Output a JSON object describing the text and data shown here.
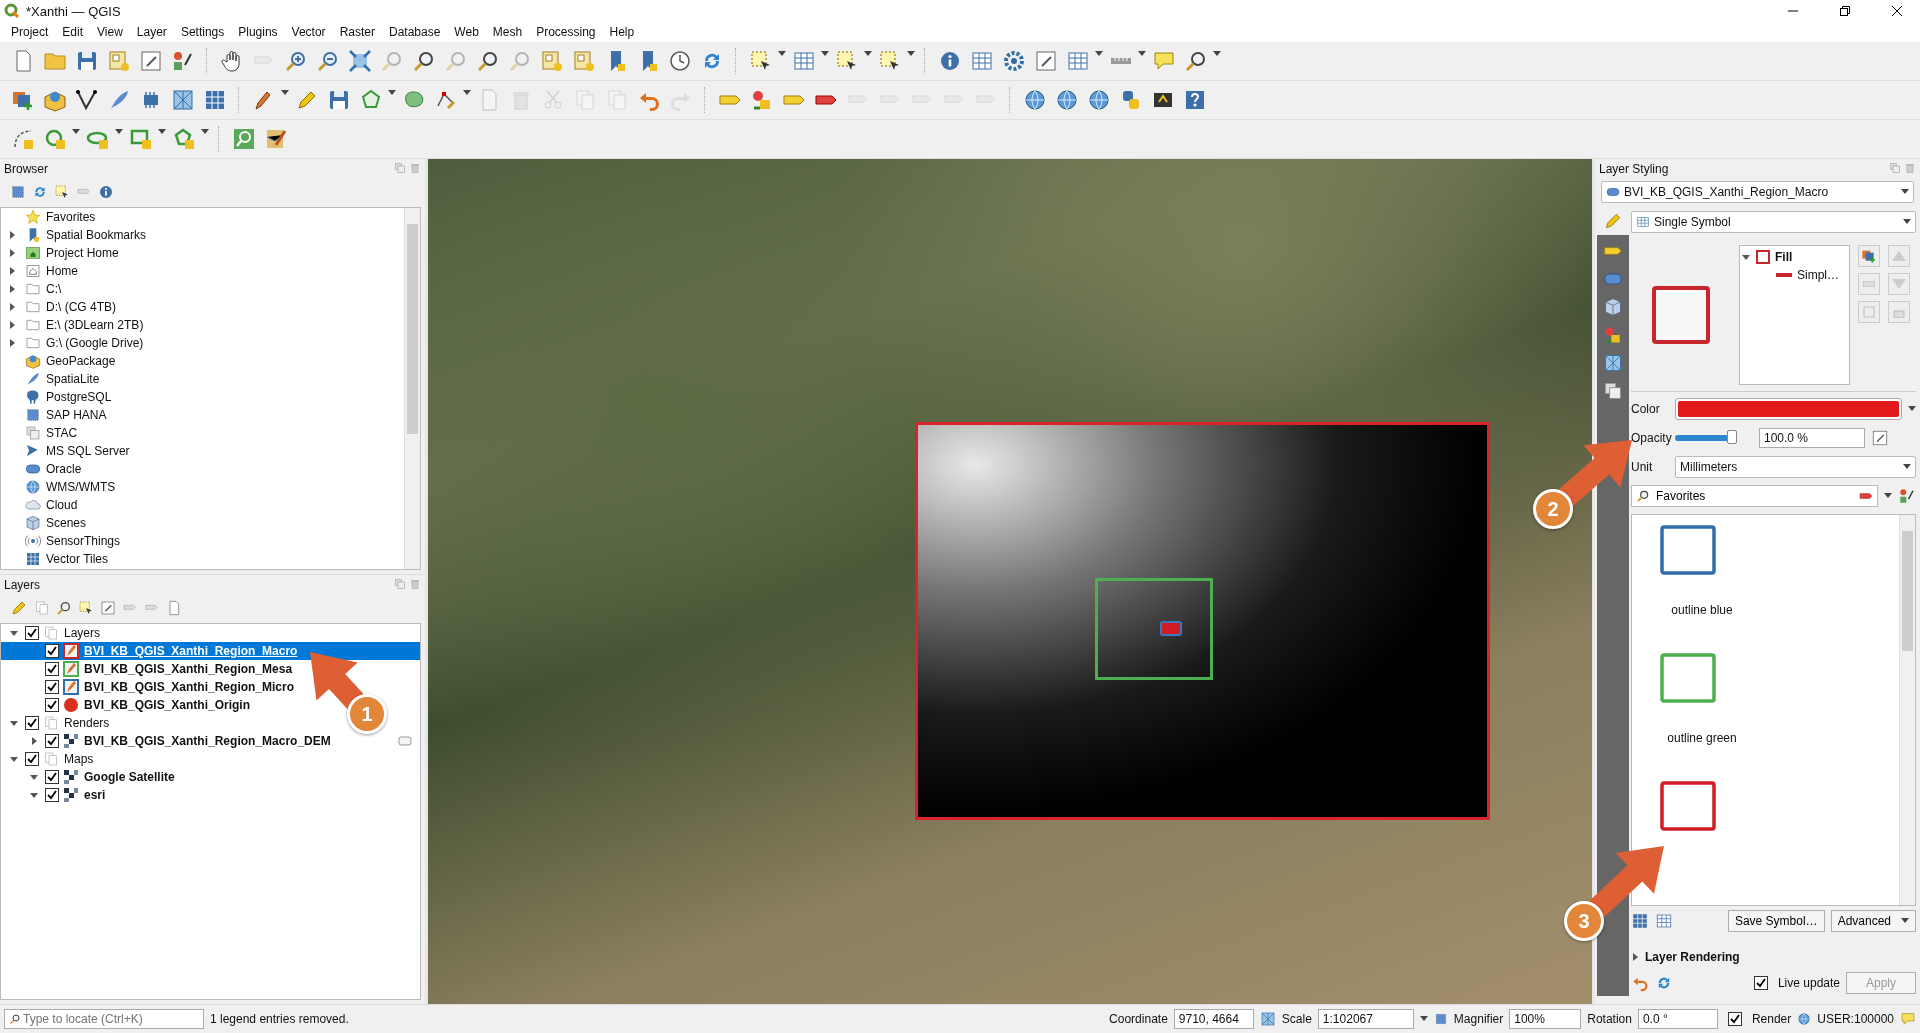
{
  "window": {
    "title": "*Xanthi — QGIS"
  },
  "menu": [
    "Project",
    "Edit",
    "View",
    "Layer",
    "Settings",
    "Plugins",
    "Vector",
    "Raster",
    "Database",
    "Web",
    "Mesh",
    "Processing",
    "Help"
  ],
  "browser": {
    "title": "Browser",
    "items": [
      {
        "label": "Favorites",
        "kind": "star",
        "expandable": false
      },
      {
        "label": "Spatial Bookmarks",
        "kind": "bookmark",
        "expandable": true
      },
      {
        "label": "Project Home",
        "kind": "project",
        "expandable": true
      },
      {
        "label": "Home",
        "kind": "home",
        "expandable": true
      },
      {
        "label": "C:\\",
        "kind": "folder",
        "expandable": true
      },
      {
        "label": "D:\\ (CG 4TB)",
        "kind": "folder",
        "expandable": true
      },
      {
        "label": "E:\\ (3DLearn 2TB)",
        "kind": "folder",
        "expandable": true
      },
      {
        "label": "G:\\ (Google Drive)",
        "kind": "folder",
        "expandable": true
      },
      {
        "label": "GeoPackage",
        "kind": "geopackage",
        "expandable": false
      },
      {
        "label": "SpatiaLite",
        "kind": "feather",
        "expandable": false
      },
      {
        "label": "PostgreSQL",
        "kind": "elephant",
        "expandable": false
      },
      {
        "label": "SAP HANA",
        "kind": "dotted-square",
        "expandable": false
      },
      {
        "label": "STAC",
        "kind": "stack",
        "expandable": false
      },
      {
        "label": "MS SQL Server",
        "kind": "fish",
        "expandable": false
      },
      {
        "label": "Oracle",
        "kind": "oval",
        "expandable": false
      },
      {
        "label": "WMS/WMTS",
        "kind": "globe",
        "expandable": false
      },
      {
        "label": "Cloud",
        "kind": "cloud",
        "expandable": false
      },
      {
        "label": "Scenes",
        "kind": "cube",
        "expandable": false
      },
      {
        "label": "SensorThings",
        "kind": "sensor",
        "expandable": false
      },
      {
        "label": "Vector Tiles",
        "kind": "grid",
        "expandable": false
      }
    ]
  },
  "layers": {
    "title": "Layers",
    "tree": [
      {
        "label": "Layers",
        "kind": "group",
        "checked": true,
        "expanded": true,
        "selected": false,
        "children": [
          {
            "label": "BVI_KB_QGIS_Xanthi_Region_Macro",
            "kind": "polygon",
            "color": "#c8262c",
            "checked": true,
            "selected": true
          },
          {
            "label": "BVI_KB_QGIS_Xanthi_Region_Mesa",
            "kind": "polygon",
            "color": "#4caf50",
            "checked": true,
            "selected": false
          },
          {
            "label": "BVI_KB_QGIS_Xanthi_Region_Micro",
            "kind": "polygon",
            "color": "#2f6ea8",
            "checked": true,
            "selected": false
          },
          {
            "label": "BVI_KB_QGIS_Xanthi_Origin",
            "kind": "point",
            "color": "#d7301f",
            "checked": true,
            "selected": false
          }
        ]
      },
      {
        "label": "Renders",
        "kind": "group",
        "checked": true,
        "expanded": true,
        "selected": false,
        "children": [
          {
            "label": "BVI_KB_QGIS_Xanthi_Region_Macro_DEM",
            "kind": "raster",
            "checked": true,
            "expanded": false,
            "selected": false,
            "embedded_widget": true
          }
        ]
      },
      {
        "label": "Maps",
        "kind": "group",
        "checked": true,
        "expanded": true,
        "selected": false,
        "children": [
          {
            "label": "Google Satellite",
            "kind": "raster",
            "checked": true,
            "expanded": true,
            "selected": false,
            "embedded_widget": false
          },
          {
            "label": "esri",
            "kind": "raster",
            "checked": true,
            "expanded": true,
            "selected": false,
            "embedded_widget": false
          }
        ]
      }
    ]
  },
  "styling": {
    "title": "Layer Styling",
    "layer": "BVI_KB_QGIS_Xanthi_Region_Macro",
    "renderer": "Single Symbol",
    "symbol_tree": {
      "label": "Fill",
      "color": "#c8262c",
      "expanded": true,
      "children": [
        {
          "label": "Simpl…",
          "color": "#c8262c"
        }
      ]
    },
    "color_field": {
      "label": "Color",
      "color": "#e31a1c"
    },
    "opacity": {
      "label": "Opacity",
      "level": 1,
      "reading": "100.0 %"
    },
    "unit": {
      "label": "Unit",
      "value": "Millimeters"
    },
    "search": {
      "value": "Favorites"
    },
    "symbols": [
      {
        "name": "outline blue",
        "color": "#2f6ea8"
      },
      {
        "name": "outline green",
        "color": "#4caf50"
      },
      {
        "color": "#d01c24"
      }
    ],
    "buttons": [
      "Save Symbol…",
      "Advanced"
    ],
    "section": {
      "label": "Layer Rendering",
      "expanded": false
    },
    "live_update": {
      "label": "Live update",
      "checked": true
    },
    "apply": {
      "label": "Apply",
      "disabled": true
    }
  },
  "status_bar": {
    "locate_placeholder": "Type to locate (Ctrl+K)",
    "message": "1 legend entries removed.",
    "coordinate_label": "Coordinate",
    "coordinate": "9710, 4664",
    "scale_label": "Scale",
    "scale": "1:102067",
    "magnifier_label": "Magnifier",
    "magnifier": "100%",
    "rotation_label": "Rotation",
    "rotation": "0.0 °",
    "render": {
      "label": "Render",
      "checked": true
    },
    "crs": "USER:100000"
  },
  "annotations": [
    "1",
    "2",
    "3"
  ]
}
